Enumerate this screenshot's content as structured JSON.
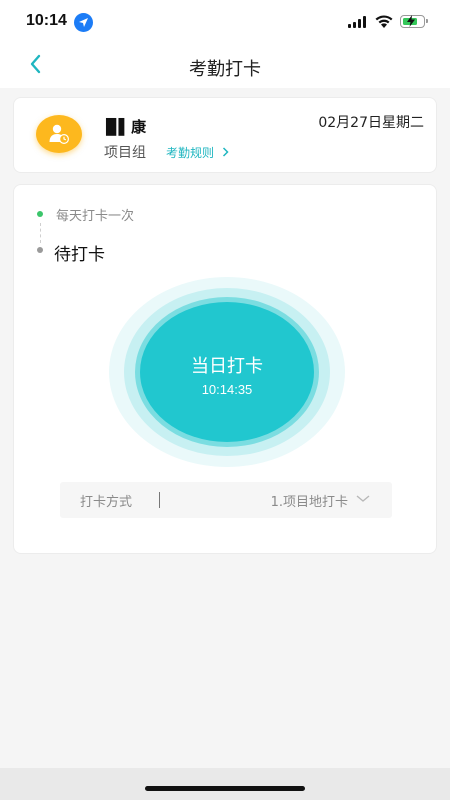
{
  "status_bar": {
    "time": "10:14",
    "icons": [
      "location-icon",
      "signal-icon",
      "wifi-icon",
      "battery-icon"
    ],
    "battery_color": "#34c759"
  },
  "nav": {
    "title": "考勤打卡",
    "back_icon": "chevron-left-icon",
    "accent_color": "#1fb6c0"
  },
  "profile": {
    "name": "▉▌康",
    "group": "项目组",
    "rules_link": "考勤规则",
    "date": "02月27日星期二",
    "avatar_icon": "user-clock-icon",
    "avatar_color": "#fdb81e"
  },
  "attendance": {
    "rule": "每天打卡一次",
    "status": "待打卡",
    "button_label": "当日打卡",
    "button_time": "10:14:35",
    "button_color": "#21c7cf",
    "method_label": "打卡方式",
    "method_value": "1.项目地打卡"
  }
}
